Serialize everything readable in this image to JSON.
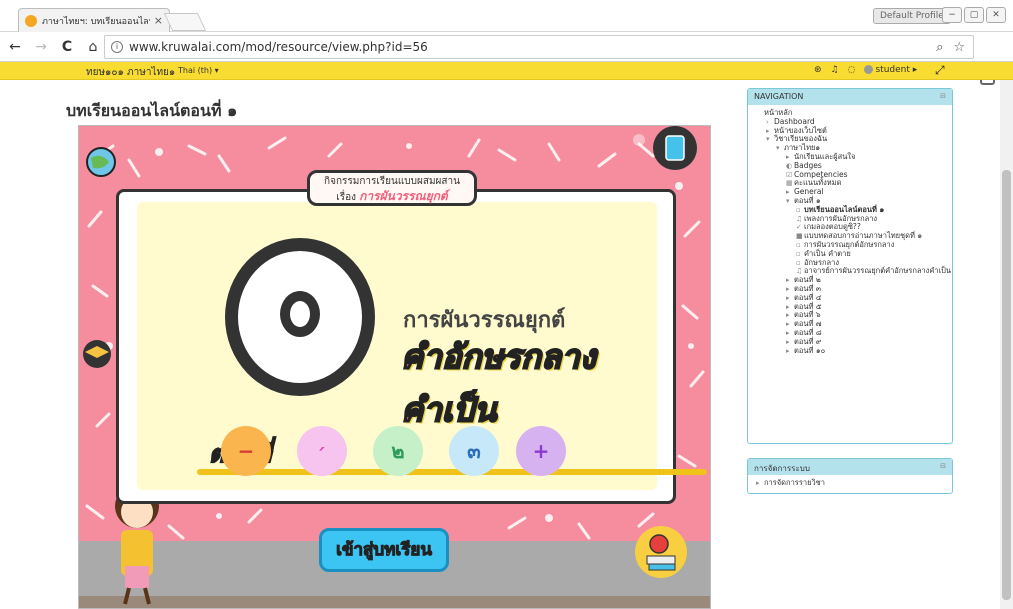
{
  "browser": {
    "tab_title": "ภาษาไทยฯ: บทเรียนออนไลน์ตอ",
    "tab_close": "×",
    "profile_label": "Default Profile",
    "url": "www.kruwalai.com/mod/resource/view.php?id=56",
    "back": "←",
    "forward": "→",
    "reload": "C",
    "home": "⌂",
    "zoom_icon": "🔍",
    "star_icon": "☆",
    "menu": "⋮"
  },
  "moodle": {
    "site_name": "ทยษ๑๐๑ ภาษาไทย๑",
    "language": "Thai (th) ▾",
    "user": "student ▸"
  },
  "main": {
    "page_title": "บทเรียนออนไลน์ตอนที่ ๑",
    "activity_line1": "กิจกรรมการเรียนแบบผสมผสาน",
    "activity_line2_prefix": "เรื่อง",
    "activity_line2_topic": "การผันวรรณยุกต์",
    "topic_line1": "การผันวรรณยุกต์",
    "topic_line2": "คำอักษรกลางคำเป็น",
    "unit_label": "ตอนที่",
    "tone_marks": [
      "−",
      "׳",
      "๒",
      "๓",
      "+"
    ],
    "start_button": "เข้าสู่บทเรียน"
  },
  "navigation": {
    "title": "NAVIGATION",
    "collapse": "⊟",
    "items": [
      {
        "level": 1,
        "icon": "",
        "label": "หน้าหลัก"
      },
      {
        "level": 2,
        "icon": "›",
        "label": "Dashboard"
      },
      {
        "level": 2,
        "icon": "▸",
        "label": "หน้าของเว็บไซต์"
      },
      {
        "level": 2,
        "icon": "▾",
        "label": "วิชาเรียนของฉัน"
      },
      {
        "level": 3,
        "icon": "▾",
        "label": "ภาษาไทย๑"
      },
      {
        "level": 4,
        "icon": "▸",
        "label": "นักเรียนและผู้สนใจ"
      },
      {
        "level": 4,
        "icon": "◐",
        "label": "Badges"
      },
      {
        "level": 4,
        "icon": "☑",
        "label": "Competencies"
      },
      {
        "level": 4,
        "icon": "▦",
        "label": "คะแนนทั้งหมด"
      },
      {
        "level": 4,
        "icon": "▸",
        "label": "General"
      },
      {
        "level": 4,
        "icon": "▾",
        "label": "ตอนที่ ๑"
      },
      {
        "level": 5,
        "icon": "▫",
        "label": "บทเรียนออนไลน์ตอนที่ ๑",
        "strong": true
      },
      {
        "level": 5,
        "icon": "♫",
        "label": "เพลงการผันอักษรกลาง"
      },
      {
        "level": 5,
        "icon": "✓",
        "label": "เกมลองตอบดูซิ??"
      },
      {
        "level": 5,
        "icon": "■",
        "label": "แบบทดสอบการอ่านภาษาไทยชุดที่ ๑"
      },
      {
        "level": 5,
        "icon": "▫",
        "label": "การผันวรรณยุกต์อักษรกลาง"
      },
      {
        "level": 5,
        "icon": "▫",
        "label": "คำเป็น คำตาย"
      },
      {
        "level": 5,
        "icon": "▫",
        "label": "อักษรกลาง"
      },
      {
        "level": 5,
        "icon": "♫",
        "label": "อาจารย์การผันวรรณยุกต์คำอักษรกลางคำเป็น"
      },
      {
        "level": 4,
        "icon": "▸",
        "label": "ตอนที่ ๒"
      },
      {
        "level": 4,
        "icon": "▸",
        "label": "ตอนที่ ๓"
      },
      {
        "level": 4,
        "icon": "▸",
        "label": "ตอนที่ ๔"
      },
      {
        "level": 4,
        "icon": "▸",
        "label": "ตอนที่ ๕"
      },
      {
        "level": 4,
        "icon": "▸",
        "label": "ตอนที่ ๖"
      },
      {
        "level": 4,
        "icon": "▸",
        "label": "ตอนที่ ๗"
      },
      {
        "level": 4,
        "icon": "▸",
        "label": "ตอนที่ ๘"
      },
      {
        "level": 4,
        "icon": "▸",
        "label": "ตอนที่ ๙"
      },
      {
        "level": 4,
        "icon": "▸",
        "label": "ตอนที่ ๑๐"
      }
    ]
  },
  "administration": {
    "title": "การจัดการระบบ",
    "collapse": "⊟",
    "item": "การจัดการรายวิชา"
  }
}
